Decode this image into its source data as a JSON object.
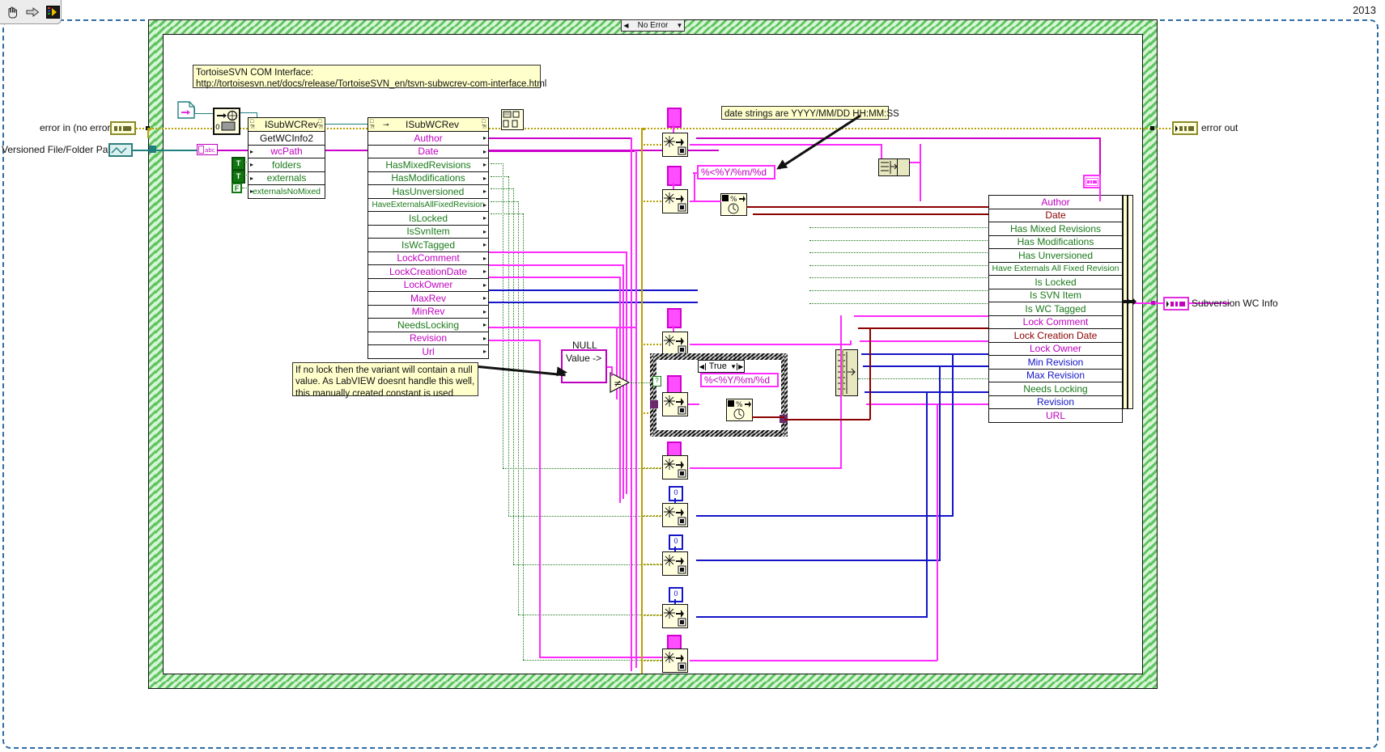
{
  "window": {
    "year_label": "2013",
    "toolbar": {
      "buttons": [
        {
          "name": "hand-tool",
          "glyph": "✋"
        },
        {
          "name": "run-arrow",
          "glyph": "⇒"
        },
        {
          "name": "labview-icon",
          "glyph": "■"
        }
      ]
    }
  },
  "diagram": {
    "case_selector": {
      "label": "No Error",
      "left_arrow": "◀",
      "right_arrow": "▼"
    },
    "comments": [
      {
        "name": "tortoisesvn-com-interface-comment",
        "lines": "TortoiseSVN COM Interface:\nhttp://tortoisesvn.net/docs/release/TortoiseSVN_en/tsvn-subwcrev-com-interface.html"
      },
      {
        "name": "date-format-comment",
        "lines": "date strings are YYYY/MM/DD HH:MM:SS"
      },
      {
        "name": "null-variant-comment",
        "lines": "If no lock then the variant will contain a null\nvalue. As LabVIEW doesnt handle this well, this\nmanually created constant is used"
      }
    ],
    "terminals": [
      {
        "name": "error-in-terminal",
        "label": "error in (no error)"
      },
      {
        "name": "versioned-path-terminal",
        "label": "Versioned File/Folder Path"
      },
      {
        "name": "error-out-terminal",
        "label": "error out"
      },
      {
        "name": "subversion-wc-info-terminal",
        "label": "Subversion WC Info"
      }
    ],
    "invoke_node": {
      "name": "isubwcrev-invoke-node",
      "class": "ISubWCRev",
      "method": "GetWCInfo2",
      "params": [
        {
          "label": "wcPath",
          "color": "magenta"
        },
        {
          "label": "folders",
          "color": "green"
        },
        {
          "label": "externals",
          "color": "green"
        },
        {
          "label": "externalsNoMixed",
          "color": "green"
        }
      ],
      "bool_constants": [
        "T",
        "T",
        "F"
      ]
    },
    "property_node": {
      "name": "isubwcrev-property-node",
      "class": "ISubWCRev",
      "properties": [
        {
          "label": "Author",
          "color": "magenta"
        },
        {
          "label": "Date",
          "color": "magenta"
        },
        {
          "label": "HasMixedRevisions",
          "color": "green"
        },
        {
          "label": "HasModifications",
          "color": "green"
        },
        {
          "label": "HasUnversioned",
          "color": "green"
        },
        {
          "label": "HaveExternalsAllFixedRevision",
          "color": "green"
        },
        {
          "label": "IsLocked",
          "color": "green"
        },
        {
          "label": "IsSvnItem",
          "color": "green"
        },
        {
          "label": "IsWcTagged",
          "color": "green"
        },
        {
          "label": "LockComment",
          "color": "magenta"
        },
        {
          "label": "LockCreationDate",
          "color": "magenta"
        },
        {
          "label": "LockOwner",
          "color": "magenta"
        },
        {
          "label": "MaxRev",
          "color": "magenta"
        },
        {
          "label": "MinRev",
          "color": "magenta"
        },
        {
          "label": "NeedsLocking",
          "color": "green"
        },
        {
          "label": "Revision",
          "color": "magenta"
        },
        {
          "label": "Url",
          "color": "magenta"
        }
      ]
    },
    "output_cluster": {
      "name": "subversion-wc-info-cluster",
      "fields": [
        {
          "label": "Author",
          "color": "magenta"
        },
        {
          "label": "Date",
          "color": "darkred"
        },
        {
          "label": "Has Mixed Revisions",
          "color": "green"
        },
        {
          "label": "Has Modifications",
          "color": "green"
        },
        {
          "label": "Has Unversioned",
          "color": "green"
        },
        {
          "label": "Have Externals All Fixed Revision",
          "color": "green"
        },
        {
          "label": "Is Locked",
          "color": "green"
        },
        {
          "label": "Is SVN Item",
          "color": "green"
        },
        {
          "label": "Is WC Tagged",
          "color": "green"
        },
        {
          "label": "Lock Comment",
          "color": "magenta"
        },
        {
          "label": "Lock Creation Date",
          "color": "darkred"
        },
        {
          "label": "Lock Owner",
          "color": "magenta"
        },
        {
          "label": "Min Revision",
          "color": "blue"
        },
        {
          "label": "Max Revision",
          "color": "blue"
        },
        {
          "label": "Needs Locking",
          "color": "green"
        },
        {
          "label": "Revision",
          "color": "blue"
        },
        {
          "label": "URL",
          "color": "magenta"
        }
      ]
    },
    "constants": [
      {
        "name": "date-format-constant-1",
        "value": "%<%Y/%m/%d "
      },
      {
        "name": "date-format-constant-2",
        "value": "%<%Y/%m/%d "
      },
      {
        "name": "null-variant-constant",
        "label": "NULL",
        "value": "Value ->"
      },
      {
        "name": "numeric-zero-1",
        "value": "0"
      },
      {
        "name": "numeric-zero-2",
        "value": "0"
      },
      {
        "name": "numeric-zero-3",
        "value": "0"
      }
    ],
    "case_structure": {
      "name": "lock-case-structure",
      "selected": "True",
      "left_arrow": "◀",
      "right_arrow": "▶",
      "down_arrow": "▼"
    }
  }
}
